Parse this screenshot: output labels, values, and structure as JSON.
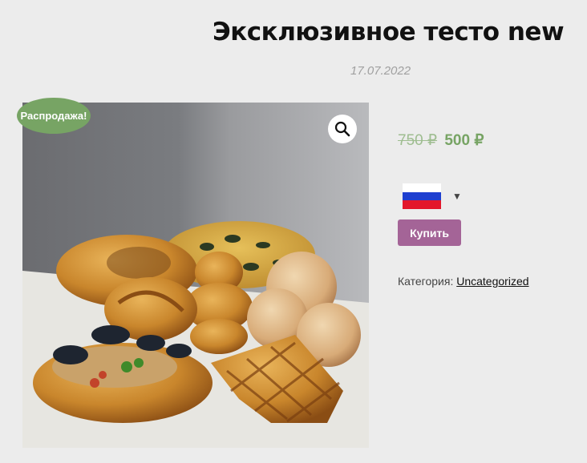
{
  "post": {
    "title": "Эксклюзивное тесто new",
    "date": "17.07.2022"
  },
  "product": {
    "sale_badge": "Распродажа!",
    "price_old": "750 ₽",
    "price_new": "500 ₽",
    "buy_label": "Купить",
    "category_label": "Категория:",
    "category_link": "Uncategorized",
    "zoom_icon": "search-icon",
    "language_flag": "russia-flag-icon"
  },
  "colors": {
    "sale": "#77a464",
    "buy_button": "#a46497",
    "background": "#ececec"
  }
}
